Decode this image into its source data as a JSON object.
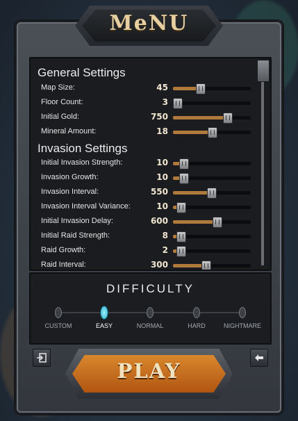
{
  "menu": {
    "title": "MeNU"
  },
  "general": {
    "heading": "General Settings",
    "rows": [
      {
        "label": "Map Size:",
        "value": "45",
        "fill": 0.35
      },
      {
        "label": "Floor Count:",
        "value": "3",
        "fill": 0.05
      },
      {
        "label": "Initial Gold:",
        "value": "750",
        "fill": 0.7
      },
      {
        "label": "Mineral Amount:",
        "value": "18",
        "fill": 0.5
      }
    ]
  },
  "invasion": {
    "heading": "Invasion Settings",
    "rows": [
      {
        "label": "Initial Invasion Strength:",
        "value": "10",
        "fill": 0.13
      },
      {
        "label": "Invasion Growth:",
        "value": "10",
        "fill": 0.13
      },
      {
        "label": "Invasion Interval:",
        "value": "550",
        "fill": 0.49
      },
      {
        "label": "Invasion Interval Variance:",
        "value": "10",
        "fill": 0.1
      },
      {
        "label": "Initial Invasion Delay:",
        "value": "600",
        "fill": 0.56
      },
      {
        "label": "Initial Raid Strength:",
        "value": "8",
        "fill": 0.1
      },
      {
        "label": "Raid Growth:",
        "value": "2",
        "fill": 0.1
      },
      {
        "label": "Raid Interval:",
        "value": "300",
        "fill": 0.42
      }
    ]
  },
  "difficulty": {
    "heading": "DIFFICULTY",
    "options": [
      "CUSTOM",
      "EASY",
      "NORMAL",
      "HARD",
      "NIGHTMARE"
    ],
    "selected": "EASY"
  },
  "buttons": {
    "play": "PLAY",
    "exit_icon": "exit-icon",
    "back_icon": "back-arrow-icon"
  }
}
